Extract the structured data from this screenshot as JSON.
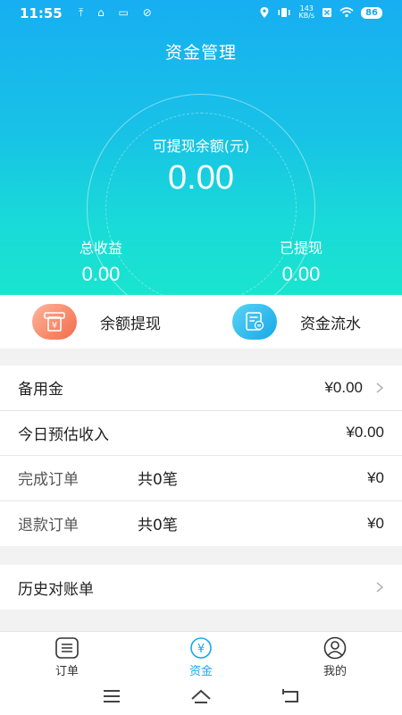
{
  "status": {
    "time": "11:55",
    "left_icons": "⤒ ⌂ ▭ ⊘",
    "net_speed_value": "143",
    "net_speed_unit": "KB/s",
    "battery": "86"
  },
  "header": {
    "title": "资金管理"
  },
  "balance": {
    "label": "可提现余额(元)",
    "value": "0.00"
  },
  "stats": {
    "total_income_label": "总收益",
    "total_income_value": "0.00",
    "withdrawn_label": "已提现",
    "withdrawn_value": "0.00"
  },
  "actions": {
    "withdraw_label": "余额提现",
    "flow_label": "资金流水"
  },
  "list": {
    "reserve_label": "备用金",
    "reserve_value": "¥0.00",
    "today_label": "今日预估收入",
    "today_value": "¥0.00",
    "completed_label": "完成订单",
    "completed_count": "共0笔",
    "completed_value": "¥0",
    "refund_label": "退款订单",
    "refund_count": "共0笔",
    "refund_value": "¥0"
  },
  "history": {
    "label": "历史对账单"
  },
  "tabs": {
    "orders": "订单",
    "funds": "资金",
    "mine": "我的",
    "active_color": "#14a9ec"
  },
  "colors": {
    "gradient_top": "#17aef2",
    "gradient_bottom": "#1ae4cf",
    "withdraw_icon": "#f26b4a",
    "flow_icon": "#18a8e8"
  }
}
